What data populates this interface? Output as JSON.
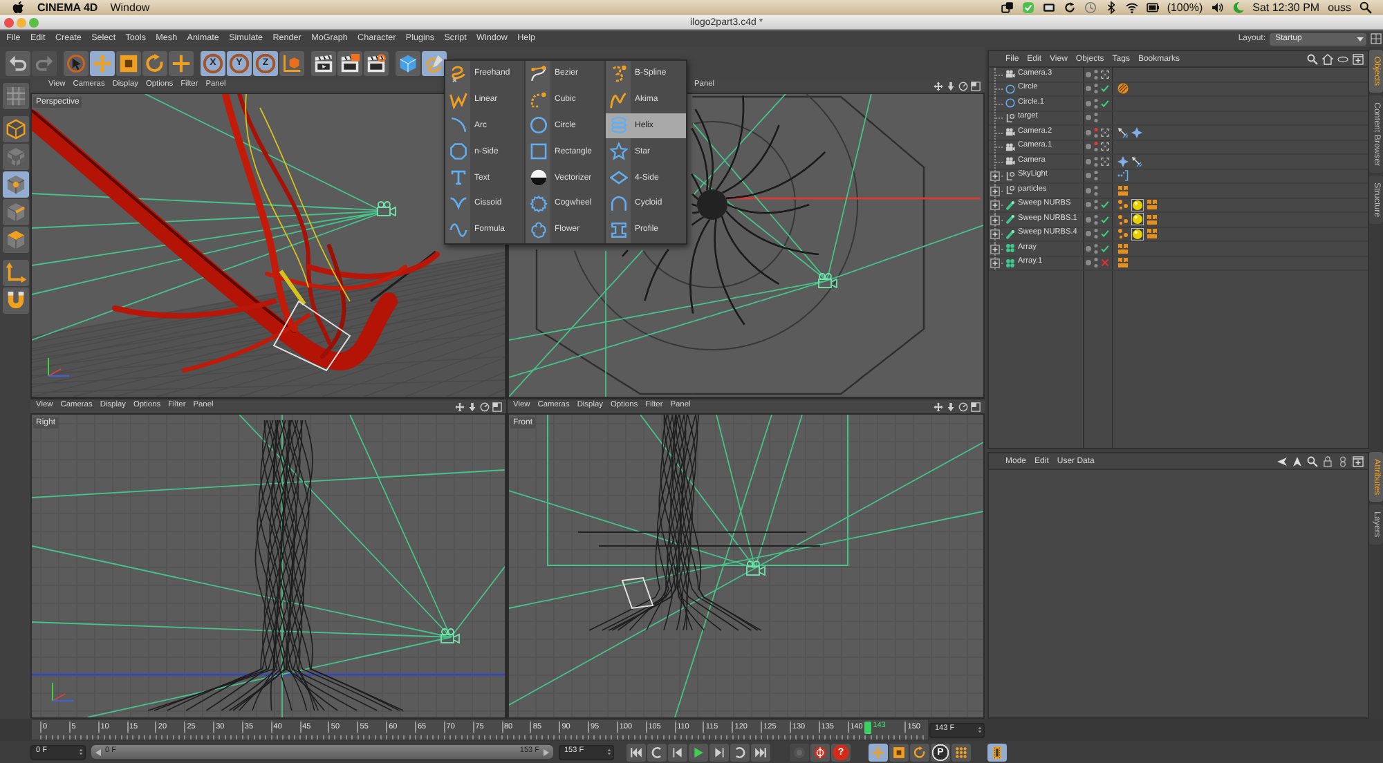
{
  "mac_menubar": {
    "app": "CINEMA 4D",
    "menus": [
      "Window"
    ],
    "battery": "(100%)",
    "clock": "Sat 12:30 PM",
    "user": "ouss"
  },
  "window": {
    "title": "ilogo2part3.c4d *"
  },
  "menu_bar": [
    "File",
    "Edit",
    "Create",
    "Select",
    "Tools",
    "Mesh",
    "Animate",
    "Simulate",
    "Render",
    "MoGraph",
    "Character",
    "Plugins",
    "Script",
    "Window",
    "Help"
  ],
  "layout": {
    "label": "Layout:",
    "value": "Startup"
  },
  "toolbar": [
    [
      {
        "kind": "undo",
        "disabled": false
      },
      {
        "kind": "redo",
        "disabled": true
      }
    ],
    [
      {
        "kind": "select",
        "selected": false
      },
      {
        "kind": "move",
        "selected": true
      },
      {
        "kind": "scale",
        "selected": false
      },
      {
        "kind": "rotate",
        "selected": false
      },
      {
        "kind": "add",
        "selected": false
      }
    ],
    [
      {
        "kind": "axis-lock",
        "label": "X",
        "selected": true
      },
      {
        "kind": "axis-lock",
        "label": "Y",
        "selected": true
      },
      {
        "kind": "axis-lock",
        "label": "Z",
        "selected": true
      },
      {
        "kind": "world",
        "selected": false
      }
    ],
    [
      {
        "kind": "render-view",
        "selected": false
      },
      {
        "kind": "render-picture",
        "selected": false
      },
      {
        "kind": "render-settings",
        "selected": false
      }
    ],
    [
      {
        "kind": "cube",
        "selected": false
      },
      {
        "kind": "spline",
        "selected": true
      }
    ]
  ],
  "left_toolbar": [
    [
      {
        "kind": "editable",
        "selected": false
      }
    ],
    [
      {
        "kind": "model",
        "selected": false
      },
      {
        "kind": "texture",
        "selected": false
      },
      {
        "kind": "points",
        "selected": true
      },
      {
        "kind": "edges",
        "selected": false
      },
      {
        "kind": "polygons",
        "selected": false
      }
    ],
    [
      {
        "kind": "object-axis",
        "selected": false
      },
      {
        "kind": "magnet",
        "selected": false
      }
    ]
  ],
  "spline_menu": {
    "columns": [
      [
        {
          "label": "Freehand",
          "kind": "freehand",
          "selected": false
        },
        {
          "label": "Linear",
          "kind": "linear",
          "selected": false
        },
        {
          "label": "Arc",
          "kind": "arc",
          "selected": false
        },
        {
          "label": "n-Side",
          "kind": "nside",
          "selected": false
        },
        {
          "label": "Text",
          "kind": "text",
          "selected": false
        },
        {
          "label": "Cissoid",
          "kind": "cissoid",
          "selected": false
        },
        {
          "label": "Formula",
          "kind": "formula",
          "selected": false
        }
      ],
      [
        {
          "label": "Bezier",
          "kind": "bezier",
          "selected": false
        },
        {
          "label": "Cubic",
          "kind": "cubic",
          "selected": false
        },
        {
          "label": "Circle",
          "kind": "circle",
          "selected": false
        },
        {
          "label": "Rectangle",
          "kind": "rectangle",
          "selected": false
        },
        {
          "label": "Vectorizer",
          "kind": "vectorizer",
          "selected": false
        },
        {
          "label": "Cogwheel",
          "kind": "cogwheel",
          "selected": false
        },
        {
          "label": "Flower",
          "kind": "flower",
          "selected": false
        }
      ],
      [
        {
          "label": "B-Spline",
          "kind": "bspline",
          "selected": false
        },
        {
          "label": "Akima",
          "kind": "akima",
          "selected": false
        },
        {
          "label": "Helix",
          "kind": "helix",
          "selected": true
        },
        {
          "label": "Star",
          "kind": "star",
          "selected": false
        },
        {
          "label": "4-Side",
          "kind": "fourside",
          "selected": false
        },
        {
          "label": "Cycloid",
          "kind": "cycloid",
          "selected": false
        },
        {
          "label": "Profile",
          "kind": "profile",
          "selected": false
        }
      ]
    ]
  },
  "viewports": [
    {
      "kind": "perspective",
      "label": "Perspective",
      "menu": [
        "View",
        "Cameras",
        "Display",
        "Options",
        "Filter",
        "Panel"
      ]
    },
    {
      "kind": "top",
      "menu": [
        "Panel"
      ],
      "nav_icons": [
        {
          "kind": "move"
        },
        {
          "kind": "down"
        },
        {
          "kind": "rotate"
        },
        {
          "kind": "maximize"
        }
      ]
    },
    {
      "kind": "side",
      "label": "Right",
      "menu": [
        "View",
        "Cameras",
        "Display",
        "Options",
        "Filter",
        "Panel"
      ],
      "nav_icons": [
        {
          "kind": "move"
        },
        {
          "kind": "down"
        },
        {
          "kind": "rotate"
        },
        {
          "kind": "maximize"
        }
      ]
    },
    {
      "kind": "front",
      "label": "Front",
      "menu": [
        "View",
        "Cameras",
        "Display",
        "Options",
        "Filter",
        "Panel"
      ],
      "nav_icons": [
        {
          "kind": "move"
        },
        {
          "kind": "down"
        },
        {
          "kind": "rotate"
        },
        {
          "kind": "maximize"
        }
      ]
    }
  ],
  "object_manager": {
    "menu": [
      "File",
      "Edit",
      "View",
      "Objects",
      "Tags",
      "Bookmarks"
    ],
    "objects": [
      {
        "name": "Camera.3",
        "kind": "camera",
        "collapsed": false,
        "editor_visible": true
      },
      {
        "name": "Circle",
        "kind": "circle",
        "collapsed": false,
        "editor_visible": true,
        "enabled": true,
        "tags": [
          {
            "kind": "disc"
          }
        ]
      },
      {
        "name": "Circle.1",
        "kind": "circle",
        "collapsed": false,
        "editor_visible": true,
        "enabled": true
      },
      {
        "name": "target",
        "kind": "null",
        "collapsed": false,
        "editor_visible": true
      },
      {
        "name": "Camera.2",
        "kind": "camera",
        "collapsed": false,
        "editor_visible": false,
        "tags": [
          {
            "kind": "target"
          },
          {
            "kind": "crosshair"
          }
        ]
      },
      {
        "name": "Camera.1",
        "kind": "camera",
        "collapsed": false,
        "editor_visible": false
      },
      {
        "name": "Camera",
        "kind": "camera",
        "collapsed": false,
        "editor_visible": true,
        "tags": [
          {
            "kind": "crosshair"
          },
          {
            "kind": "target"
          }
        ]
      },
      {
        "name": "SkyLight",
        "kind": "null",
        "collapsed": true,
        "editor_visible": true,
        "tags": [
          {
            "kind": "bracket"
          }
        ]
      },
      {
        "name": "particles",
        "kind": "null",
        "collapsed": true,
        "editor_visible": true,
        "tags": [
          {
            "kind": "xpresso"
          }
        ]
      },
      {
        "name": "Sweep NURBS",
        "kind": "sweep",
        "collapsed": true,
        "editor_visible": true,
        "enabled": true,
        "tags": [
          {
            "kind": "dots"
          },
          {
            "kind": "material"
          },
          {
            "kind": "xpresso"
          }
        ]
      },
      {
        "name": "Sweep NURBS.1",
        "kind": "sweep",
        "collapsed": true,
        "editor_visible": true,
        "enabled": true,
        "tags": [
          {
            "kind": "dots"
          },
          {
            "kind": "material"
          },
          {
            "kind": "xpresso"
          }
        ]
      },
      {
        "name": "Sweep NURBS.4",
        "kind": "sweep",
        "collapsed": true,
        "editor_visible": true,
        "enabled": true,
        "tags": [
          {
            "kind": "dots"
          },
          {
            "kind": "material"
          },
          {
            "kind": "xpresso"
          }
        ]
      },
      {
        "name": "Array",
        "kind": "array",
        "collapsed": true,
        "editor_visible": true,
        "enabled": true,
        "tags": [
          {
            "kind": "xpresso"
          }
        ]
      },
      {
        "name": "Array.1",
        "kind": "array",
        "collapsed": true,
        "editor_visible": true,
        "enabled": false,
        "tags": [
          {
            "kind": "xpresso"
          }
        ]
      }
    ]
  },
  "object_tabs": [
    {
      "label": "Objects",
      "selected": true
    },
    {
      "label": "Content Browser",
      "selected": false
    },
    {
      "label": "Structure",
      "selected": false
    }
  ],
  "attributes": {
    "menu": [
      "Mode",
      "Edit",
      "User Data"
    ]
  },
  "attribute_tabs": [
    {
      "label": "Attributes",
      "selected": true
    },
    {
      "label": "Layers",
      "selected": false
    }
  ],
  "timeline": {
    "ticks": [
      "0",
      "5",
      "10",
      "15",
      "20",
      "25",
      "30",
      "35",
      "40",
      "45",
      "50",
      "55",
      "60",
      "65",
      "70",
      "75",
      "80",
      "85",
      "90",
      "95",
      "100",
      "105",
      "110",
      "115",
      "120",
      "125",
      "130",
      "135",
      "140"
    ],
    "end_tick": "150",
    "current": "143",
    "level": 0.9286,
    "frame_field": "143 F"
  },
  "transport": {
    "start_field": "0 F",
    "range": {
      "start": "0 F",
      "end": "153 F",
      "level": 1
    },
    "end_field": "153 F",
    "playback": [
      {
        "kind": "go-start"
      },
      {
        "kind": "prev-key"
      },
      {
        "kind": "prev-frame"
      },
      {
        "kind": "play"
      },
      {
        "kind": "next-frame"
      },
      {
        "kind": "next-key"
      },
      {
        "kind": "go-end"
      }
    ],
    "record": [
      {
        "kind": "autokey",
        "disabled": true
      },
      {
        "kind": "record",
        "disabled": false
      },
      {
        "kind": "help",
        "label": "?",
        "disabled": false
      }
    ],
    "keys": [
      {
        "kind": "key-move",
        "selected": true
      },
      {
        "kind": "key-scale",
        "selected": false
      },
      {
        "kind": "key-rotate",
        "selected": false
      },
      {
        "kind": "param",
        "label": "P",
        "selected": false
      },
      {
        "kind": "grid",
        "selected": false
      }
    ],
    "film": [
      {
        "kind": "film",
        "selected": true
      }
    ]
  }
}
